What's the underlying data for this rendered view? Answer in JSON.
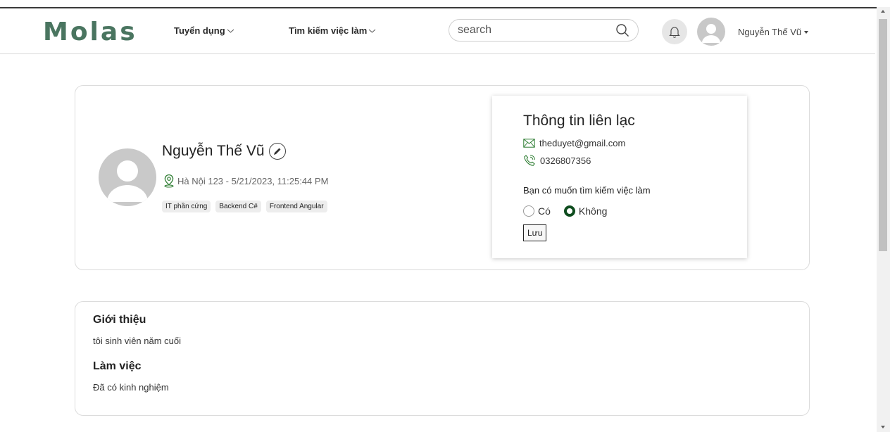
{
  "header": {
    "logo": "Molas",
    "nav": [
      {
        "label": "Tuyển dụng"
      },
      {
        "label": "Tìm kiếm việc làm"
      }
    ],
    "search": {
      "placeholder": "search",
      "value": ""
    },
    "user_name": "Nguyễn Thế Vũ"
  },
  "profile": {
    "name": "Nguyễn Thế Vũ",
    "location": "Hà Nội 123 - 5/21/2023, 11:25:44 PM",
    "tags": [
      "IT phần cứng",
      "Backend C#",
      "Frontend Angular"
    ]
  },
  "contact": {
    "title": "Thông tin liên lạc",
    "email": "theduyet@gmail.com",
    "phone": "0326807356",
    "question": "Bạn có muốn tìm kiếm việc làm",
    "options": [
      {
        "label": "Có",
        "selected": false
      },
      {
        "label": "Không",
        "selected": true
      }
    ],
    "save_label": "Lưu"
  },
  "about": {
    "intro_title": "Giới thiệu",
    "intro_text": "tôi sinh viên năm cuối",
    "work_title": "Làm việc",
    "work_text": "Đã có kinh nghiệm"
  },
  "colors": {
    "brand": "#4a7560",
    "radio_selected": "#0f4d1f",
    "location_icon": "#2e7d32",
    "phone_icon": "#2e7d32"
  }
}
